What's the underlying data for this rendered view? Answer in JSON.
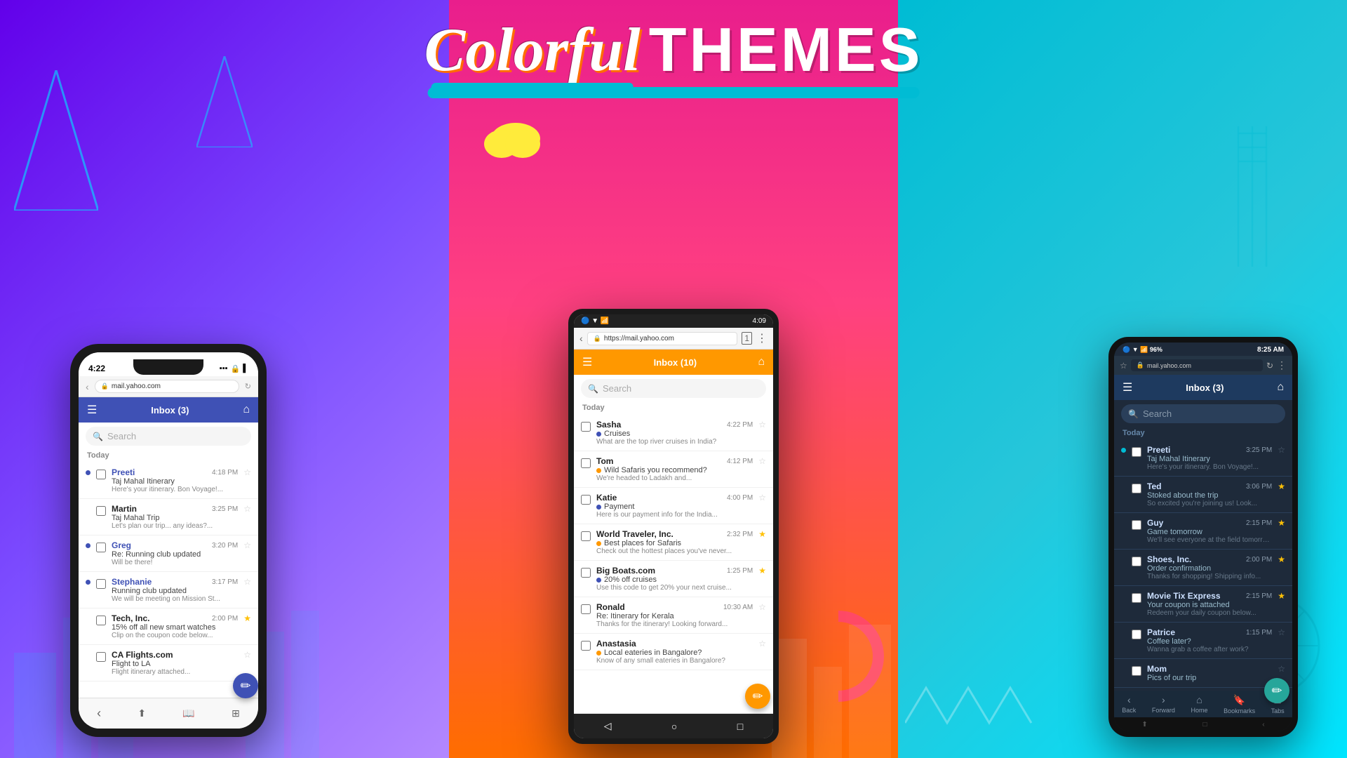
{
  "title": {
    "colorful": "Colorful",
    "themes": "THEMES"
  },
  "panels": {
    "left": {
      "bg1": "#6200ea",
      "bg2": "#9c27b0"
    },
    "middle": {
      "bg1": "#e91e8c",
      "bg2": "#ff6d00"
    },
    "right": {
      "bg1": "#00bcd4",
      "bg2": "#26c6da"
    }
  },
  "phone_left": {
    "status": "4:22",
    "url": "mail.yahoo.com",
    "nav_label": "Inbox (3)",
    "search_placeholder": "Search",
    "section": "Today",
    "emails": [
      {
        "sender": "Preeti",
        "time": "4:18 PM",
        "subject": "Taj Mahal Itinerary",
        "preview": "Here's your itinerary. Bon Voyage!...",
        "unread": true,
        "starred": false
      },
      {
        "sender": "Martin",
        "time": "3:25 PM",
        "subject": "Taj Mahal Trip",
        "preview": "Let's plan our trip... any ideas?...",
        "unread": false,
        "starred": false
      },
      {
        "sender": "Greg",
        "time": "3:20 PM",
        "subject": "Re: Running club updated",
        "preview": "Will be there!",
        "unread": true,
        "starred": false
      },
      {
        "sender": "Stephanie",
        "time": "3:17 PM",
        "subject": "Running club updated",
        "preview": "We will be meeting on Mission St...",
        "unread": true,
        "starred": false
      },
      {
        "sender": "Tech, Inc.",
        "time": "2:00 PM",
        "subject": "15% off all new smart watches",
        "preview": "Clip on the coupon code below...",
        "unread": false,
        "starred": true
      },
      {
        "sender": "CA Flights.com",
        "time": "",
        "subject": "Flight to LA",
        "preview": "Flight itinerary attached...",
        "unread": false,
        "starred": false
      }
    ]
  },
  "phone_middle": {
    "status_time": "4:09",
    "url": "https://mail.yahoo.com",
    "nav_label": "Inbox (10)",
    "search_placeholder": "Search",
    "section": "Today",
    "emails": [
      {
        "sender": "Sasha",
        "time": "4:22 PM",
        "subject": "Cruises",
        "preview": "What are the top river cruises in India?",
        "unread": true,
        "starred": false,
        "subject_color": "blue"
      },
      {
        "sender": "Tom",
        "time": "4:12 PM",
        "subject": "Wild Safaris you recommend?",
        "preview": "We're headed to Ladakh and...",
        "unread": false,
        "starred": false,
        "subject_color": "orange"
      },
      {
        "sender": "Katie",
        "time": "4:00 PM",
        "subject": "Payment",
        "preview": "Here is our payment info for the India...",
        "unread": false,
        "starred": false,
        "subject_color": "blue"
      },
      {
        "sender": "World Traveler, Inc.",
        "time": "2:32 PM",
        "subject": "Best places for Safaris",
        "preview": "Check out the hottest places you've never...",
        "unread": false,
        "starred": true,
        "subject_color": "orange"
      },
      {
        "sender": "Big Boats.com",
        "time": "1:25 PM",
        "subject": "20% off cruises",
        "preview": "Use this code to get 20% your next cruise...",
        "unread": false,
        "starred": true,
        "subject_color": "blue"
      },
      {
        "sender": "Ronald",
        "time": "10:30 AM",
        "subject": "Re: Itinerary for Kerala",
        "preview": "Thanks for the itinerary! Looking forward...",
        "unread": false,
        "starred": false,
        "subject_color": ""
      },
      {
        "sender": "Anastasia",
        "time": "",
        "subject": "Local eateries in Bangalore?",
        "preview": "Know of any small eateries in Bangalore?",
        "unread": false,
        "starred": false,
        "subject_color": "orange"
      }
    ]
  },
  "phone_right": {
    "status_time": "8:25 AM",
    "url": "mail.yahoo.com",
    "nav_label": "Inbox (3)",
    "search_placeholder": "Search",
    "section": "Today",
    "emails": [
      {
        "sender": "Preeti",
        "time": "3:25 PM",
        "subject": "Taj Mahal Itinerary",
        "preview": "Here's your itinerary. Bon Voyage!...",
        "unread": true,
        "starred": false
      },
      {
        "sender": "Ted",
        "time": "3:06 PM",
        "subject": "Stoked about the trip",
        "preview": "So excited you're joining us! Look...",
        "unread": false,
        "starred": true
      },
      {
        "sender": "Guy",
        "time": "2:15 PM",
        "subject": "Game tomorrow",
        "preview": "We'll see everyone at the field tomorrow at...",
        "unread": false,
        "starred": true
      },
      {
        "sender": "Shoes, Inc.",
        "time": "2:00 PM",
        "subject": "Order confirmation",
        "preview": "Thanks for shopping! Shipping info...",
        "unread": false,
        "starred": true
      },
      {
        "sender": "Movie Tix Express",
        "time": "2:15 PM",
        "subject": "Your coupon is attached",
        "preview": "Redeem your daily coupon below...",
        "unread": false,
        "starred": true
      },
      {
        "sender": "Patrice",
        "time": "1:15 PM",
        "subject": "Coffee later?",
        "preview": "Wanna grab a coffee after work?",
        "unread": false,
        "starred": false
      },
      {
        "sender": "Mom",
        "time": "",
        "subject": "Pics of our trip",
        "preview": "",
        "unread": false,
        "starred": false
      }
    ],
    "bottom_nav": [
      "Back",
      "Forward",
      "Home",
      "Bookmarks",
      "Tabs"
    ]
  }
}
